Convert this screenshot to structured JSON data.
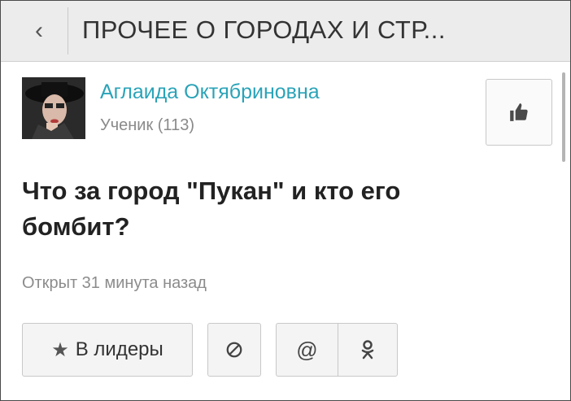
{
  "header": {
    "back_icon": "chevron-left-icon",
    "title": "ПРОЧЕЕ О ГОРОДАХ И СТР..."
  },
  "author": {
    "name": "Аглаида Октябриновна",
    "rank": "Ученик (113)"
  },
  "like": {
    "icon": "thumbs-up-icon"
  },
  "question": {
    "text": "Что за город \"Пукан\" и кто его бомбит?",
    "opened": "Открыт 31 минута назад"
  },
  "actions": {
    "leaders_label": "В лидеры",
    "leaders_icon": "star-icon",
    "block_icon": "block-icon",
    "mail_icon": "at-sign-icon",
    "ok_icon": "odnoklassniki-icon"
  },
  "colors": {
    "accent": "#2aa3b8",
    "header_bg": "#ececec"
  }
}
